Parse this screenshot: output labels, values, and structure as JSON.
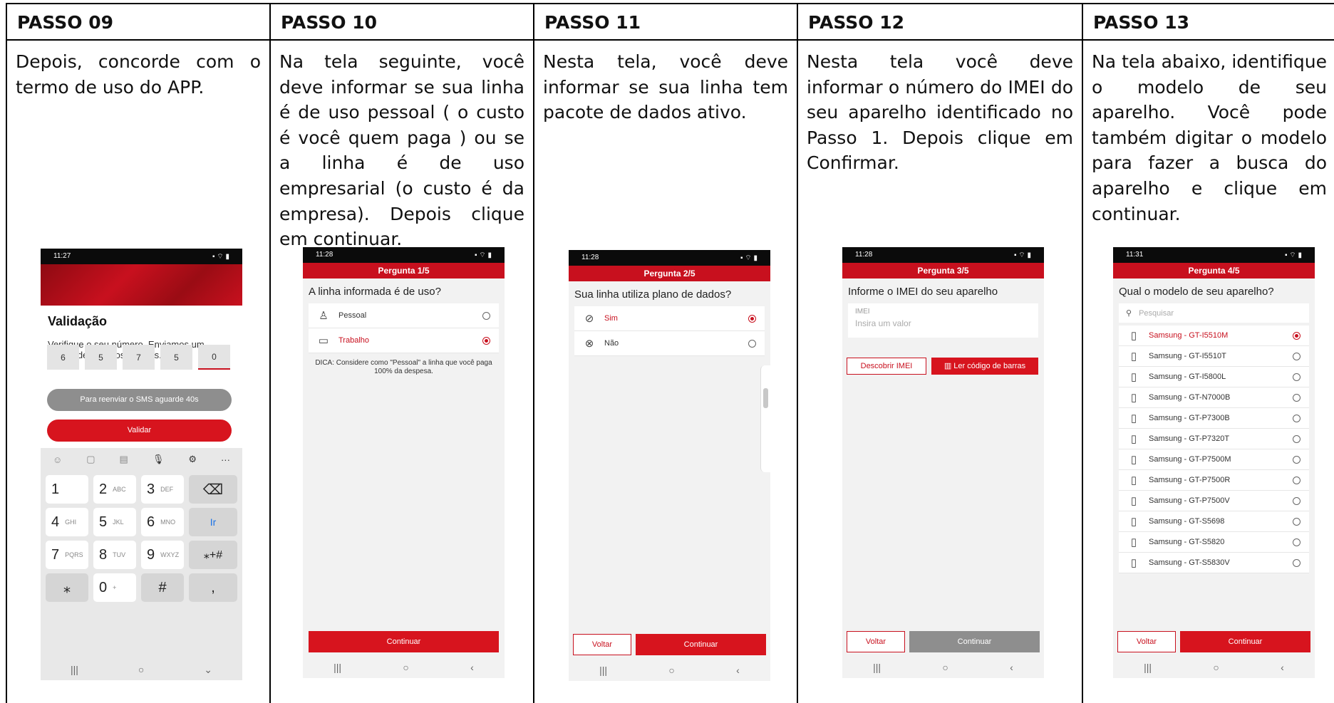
{
  "steps": [
    {
      "header": "PASSO 09",
      "text": "Depois, concorde com o termo de uso do APP."
    },
    {
      "header": "PASSO 10",
      "text": "Na tela seguinte, você deve informar se sua linha é de uso pessoal ( o custo é você quem paga ) ou se a linha é de uso empresarial (o custo é da empresa). Depois clique em continuar."
    },
    {
      "header": "PASSO 11",
      "text": "Nesta tela, você deve informar se sua linha tem pacote de dados ativo."
    },
    {
      "header": "PASSO 12",
      "text": "Nesta tela você deve informar o número do IMEI do seu aparelho identificado no Passo 1. Depois clique em Confirmar."
    },
    {
      "header": "PASSO 13",
      "text": "Na tela abaixo, identifique o modelo de seu aparelho. Você pode também digitar o modelo para fazer a busca do aparelho e clique em continuar."
    }
  ],
  "phone09": {
    "time": "11:27",
    "title": "Validação",
    "message": "Verifique o seu número. Enviamos um código de 5 digitos via sms.",
    "digits": [
      "6",
      "5",
      "7",
      "5",
      "0"
    ],
    "resend": "Para reenviar o SMS aguarde 40s",
    "validate": "Validar",
    "keys": [
      {
        "main": "1",
        "sub": ""
      },
      {
        "main": "2",
        "sub": "ABC"
      },
      {
        "main": "3",
        "sub": "DEF"
      },
      {
        "main": "4",
        "sub": "GHI"
      },
      {
        "main": "5",
        "sub": "JKL"
      },
      {
        "main": "6",
        "sub": "MNO"
      },
      {
        "main": "7",
        "sub": "PQRS"
      },
      {
        "main": "8",
        "sub": "TUV"
      },
      {
        "main": "9",
        "sub": "WXYZ"
      },
      {
        "main": "⁎",
        "sub": ""
      },
      {
        "main": "0",
        "sub": "+"
      },
      {
        "main": "#",
        "sub": ""
      }
    ],
    "key_go": "Ir",
    "key_sym": "⁎+#",
    "key_comma": ","
  },
  "phone10": {
    "time": "11:28",
    "title": "Pergunta 1/5",
    "question": "A linha informada é de uso?",
    "options": [
      "Pessoal",
      "Trabalho"
    ],
    "tip": "DICA: Considere como \"Pessoal\" a linha que você paga 100% da despesa.",
    "continue": "Continuar"
  },
  "phone11": {
    "time": "11:28",
    "title": "Pergunta 2/5",
    "question": "Sua linha utiliza plano de dados?",
    "options": [
      "Sim",
      "Não"
    ],
    "back": "Voltar",
    "continue": "Continuar"
  },
  "phone12": {
    "time": "11:28",
    "title": "Pergunta 3/5",
    "question": "Informe o IMEI do seu aparelho",
    "field_label": "IMEI",
    "placeholder": "Insira um valor",
    "discover": "Descobrir IMEI",
    "barcode": "Ler código de barras",
    "back": "Voltar",
    "continue": "Continuar"
  },
  "phone13": {
    "time": "11:31",
    "title": "Pergunta 4/5",
    "question": "Qual o modelo de seu aparelho?",
    "search": "Pesquisar",
    "models": [
      "Samsung - GT-I5510M",
      "Samsung - GT-I5510T",
      "Samsung - GT-I5800L",
      "Samsung - GT-N7000B",
      "Samsung - GT-P7300B",
      "Samsung - GT-P7320T",
      "Samsung - GT-P7500M",
      "Samsung - GT-P7500R",
      "Samsung - GT-P7500V",
      "Samsung - GT-S5698",
      "Samsung - GT-S5820",
      "Samsung - GT-S5830V"
    ],
    "back": "Voltar",
    "continue": "Continuar"
  },
  "colors": {
    "accent": "#d7141e",
    "disabled": "#8e8e8e"
  },
  "icons": {
    "nav": [
      "recents-icon",
      "home-icon",
      "back-icon"
    ]
  }
}
